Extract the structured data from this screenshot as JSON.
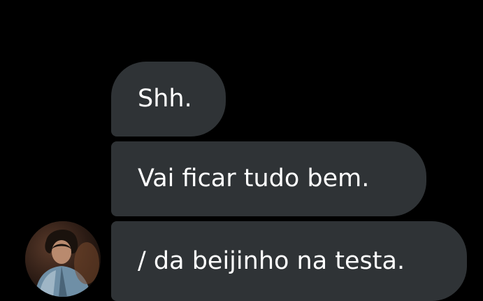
{
  "messages": [
    {
      "text": "Shh."
    },
    {
      "text": "Vai ficar tudo bem."
    },
    {
      "text": "/ da beijinho na testa."
    }
  ],
  "avatar": {
    "icon": "user-avatar-photo"
  },
  "colors": {
    "background": "#000000",
    "bubble": "#2f3336",
    "text": "#ffffff"
  }
}
